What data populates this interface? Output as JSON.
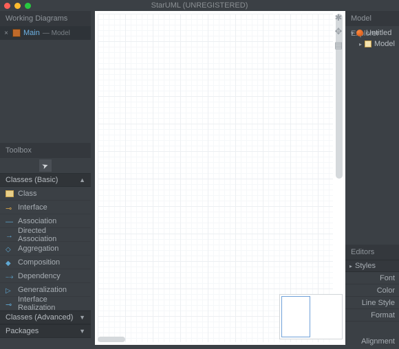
{
  "titlebar": {
    "title": "StarUML (UNREGISTERED)"
  },
  "workingDiagrams": {
    "header": "Working Diagrams",
    "items": [
      {
        "name": "Main",
        "sub": "— Model"
      }
    ]
  },
  "toolbox": {
    "header": "Toolbox",
    "groups": [
      {
        "label": "Classes (Basic)",
        "expanded": true,
        "items": [
          {
            "label": "Class",
            "iconClass": "ic-class"
          },
          {
            "label": "Interface",
            "iconClass": "ic-if"
          },
          {
            "label": "Association",
            "iconClass": "ic-assoc"
          },
          {
            "label": "Directed Association",
            "iconClass": "ic-dassoc"
          },
          {
            "label": "Aggregation",
            "iconClass": "ic-agg"
          },
          {
            "label": "Composition",
            "iconClass": "ic-comp"
          },
          {
            "label": "Dependency",
            "iconClass": "ic-dep"
          },
          {
            "label": "Generalization",
            "iconClass": "ic-gen"
          },
          {
            "label": "Interface Realization",
            "iconClass": "ic-ireal"
          }
        ]
      },
      {
        "label": "Classes (Advanced)",
        "expanded": false,
        "items": []
      },
      {
        "label": "Packages",
        "expanded": false,
        "items": []
      }
    ]
  },
  "modelExplorer": {
    "header": "Model Explorer",
    "root": {
      "label": "Untitled"
    },
    "child": {
      "label": "Model"
    }
  },
  "editors": {
    "header": "Editors",
    "stylesHeader": "Styles",
    "rows": [
      {
        "label": "Font"
      },
      {
        "label": "Color"
      },
      {
        "label": "Line Style"
      },
      {
        "label": "Format"
      }
    ],
    "alignment": "Alignment"
  },
  "rightIcons": {
    "ext": "extension-manager-icon",
    "col": "collaboration-icon",
    "view": "diagram-thumbnails-icon"
  }
}
